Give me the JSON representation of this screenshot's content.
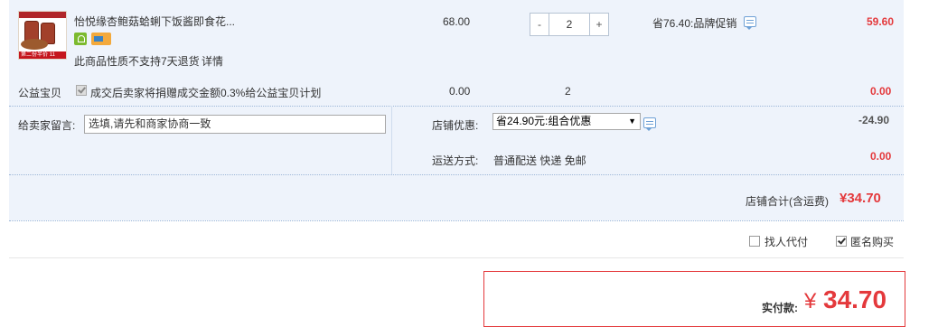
{
  "item": {
    "title": "怡悦缘杏鲍菇蛤蜊下饭酱即食花...",
    "unit_price": "68.00",
    "quantity": "2",
    "minus_label": "-",
    "plus_label": "+",
    "promo": "省76.40:品牌促销",
    "subtotal": "59.60",
    "return_note": "此商品性质不支持7天退货",
    "details_link": "详情",
    "thumb_tag": "第二份半价",
    "thumb_num": "11"
  },
  "charity": {
    "label": "公益宝贝",
    "desc": "成交后卖家将捐赠成交金额0.3%给公益宝贝计划",
    "amount": "0.00",
    "count": "2",
    "total": "0.00",
    "checked": true
  },
  "message": {
    "label": "给卖家留言:",
    "placeholder": "选填,请先和商家协商一致"
  },
  "discount": {
    "label": "店铺优惠:",
    "selected": "省24.90元:组合优惠",
    "amount": "-24.90"
  },
  "shipping": {
    "label": "运送方式:",
    "value": "普通配送 快递 免邮",
    "amount": "0.00"
  },
  "store_total": {
    "label": "店铺合计(含运费)",
    "value": "¥34.70"
  },
  "options": {
    "proxy_pay": "找人代付",
    "anonymous": "匿名购买"
  },
  "payment": {
    "label": "实付款:",
    "currency": "¥",
    "amount": "34.70"
  },
  "colors": {
    "accent": "#e4393c",
    "panel": "#eef3fb"
  }
}
